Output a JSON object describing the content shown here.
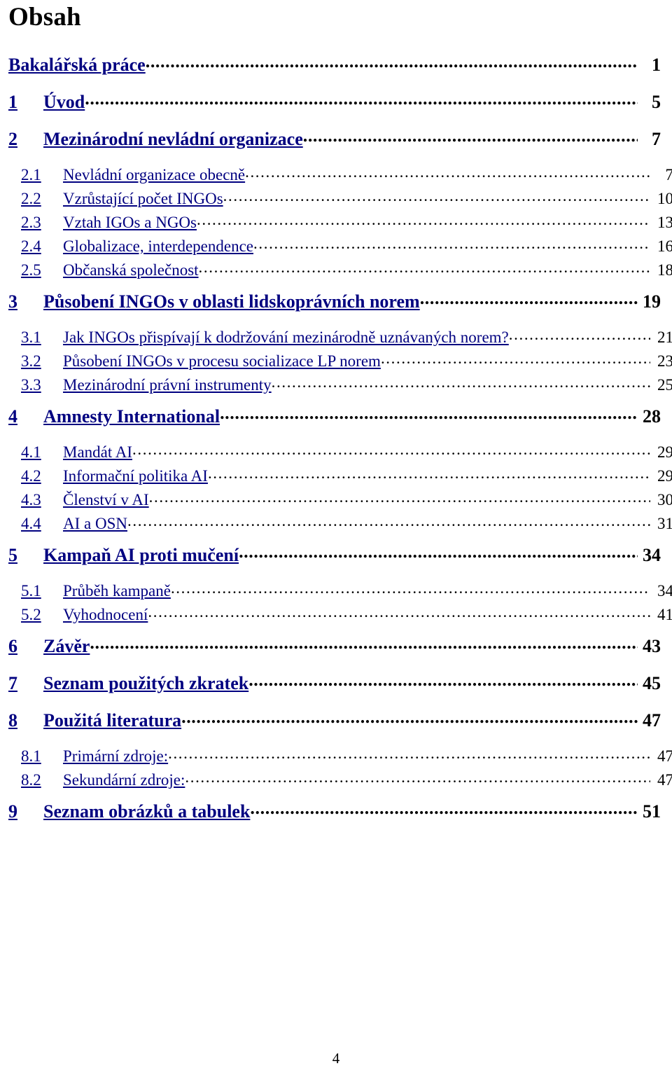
{
  "document": {
    "title": "Obsah",
    "footer_page_number": "4",
    "link_color": "#000080",
    "text_color": "#000000"
  },
  "toc": {
    "entries": [
      {
        "level": 0,
        "number": "",
        "label": "Bakalářská práce",
        "page": "1"
      },
      {
        "level": 1,
        "number": "1",
        "label": "Úvod",
        "page": "5"
      },
      {
        "level": 1,
        "number": "2",
        "label": "Mezinárodní nevládní organizace",
        "page": "7"
      },
      {
        "level": 2,
        "number": "2.1",
        "label": "Nevládní organizace obecně",
        "page": "7"
      },
      {
        "level": 2,
        "number": "2.2",
        "label": "Vzrůstající počet INGOs",
        "page": "10"
      },
      {
        "level": 2,
        "number": "2.3",
        "label": "Vztah IGOs a NGOs",
        "page": "13"
      },
      {
        "level": 2,
        "number": "2.4",
        "label": "Globalizace, interdependence",
        "page": "16"
      },
      {
        "level": 2,
        "number": "2.5",
        "label": "Občanská společnost",
        "page": "18"
      },
      {
        "level": 1,
        "number": "3",
        "label": "Působení INGOs v oblasti lidskoprávních norem",
        "page": "19"
      },
      {
        "level": 2,
        "number": "3.1",
        "label": "Jak INGOs přispívají k dodržování mezinárodně uznávaných norem?",
        "page": "21"
      },
      {
        "level": 2,
        "number": "3.2",
        "label": "Působení INGOs v procesu socializace LP norem",
        "page": "23"
      },
      {
        "level": 2,
        "number": "3.3",
        "label": "Mezinárodní právní instrumenty",
        "page": "25"
      },
      {
        "level": 1,
        "number": "4",
        "label": "Amnesty International",
        "page": "28"
      },
      {
        "level": 2,
        "number": "4.1",
        "label": "Mandát AI",
        "page": "29"
      },
      {
        "level": 2,
        "number": "4.2",
        "label": "Informační politika AI",
        "page": "29"
      },
      {
        "level": 2,
        "number": "4.3",
        "label": "Členství v AI",
        "page": "30"
      },
      {
        "level": 2,
        "number": "4.4",
        "label": "AI a OSN",
        "page": "31"
      },
      {
        "level": 1,
        "number": "5",
        "label": "Kampaň AI proti mučení",
        "page": "34"
      },
      {
        "level": 2,
        "number": "5.1",
        "label": "Průběh kampaně",
        "page": "34"
      },
      {
        "level": 2,
        "number": "5.2",
        "label": "Vyhodnocení",
        "page": "41"
      },
      {
        "level": 1,
        "number": "6",
        "label": "Závěr",
        "page": "43"
      },
      {
        "level": 1,
        "number": "7",
        "label": "Seznam použitých zkratek",
        "page": "45"
      },
      {
        "level": 1,
        "number": "8",
        "label": "Použitá literatura",
        "page": "47"
      },
      {
        "level": 2,
        "number": "8.1",
        "label": "Primární zdroje:",
        "page": "47"
      },
      {
        "level": 2,
        "number": "8.2",
        "label": "Sekundární zdroje:",
        "page": "47"
      },
      {
        "level": 1,
        "number": "9",
        "label": "Seznam obrázků a tabulek",
        "page": "51"
      }
    ]
  }
}
